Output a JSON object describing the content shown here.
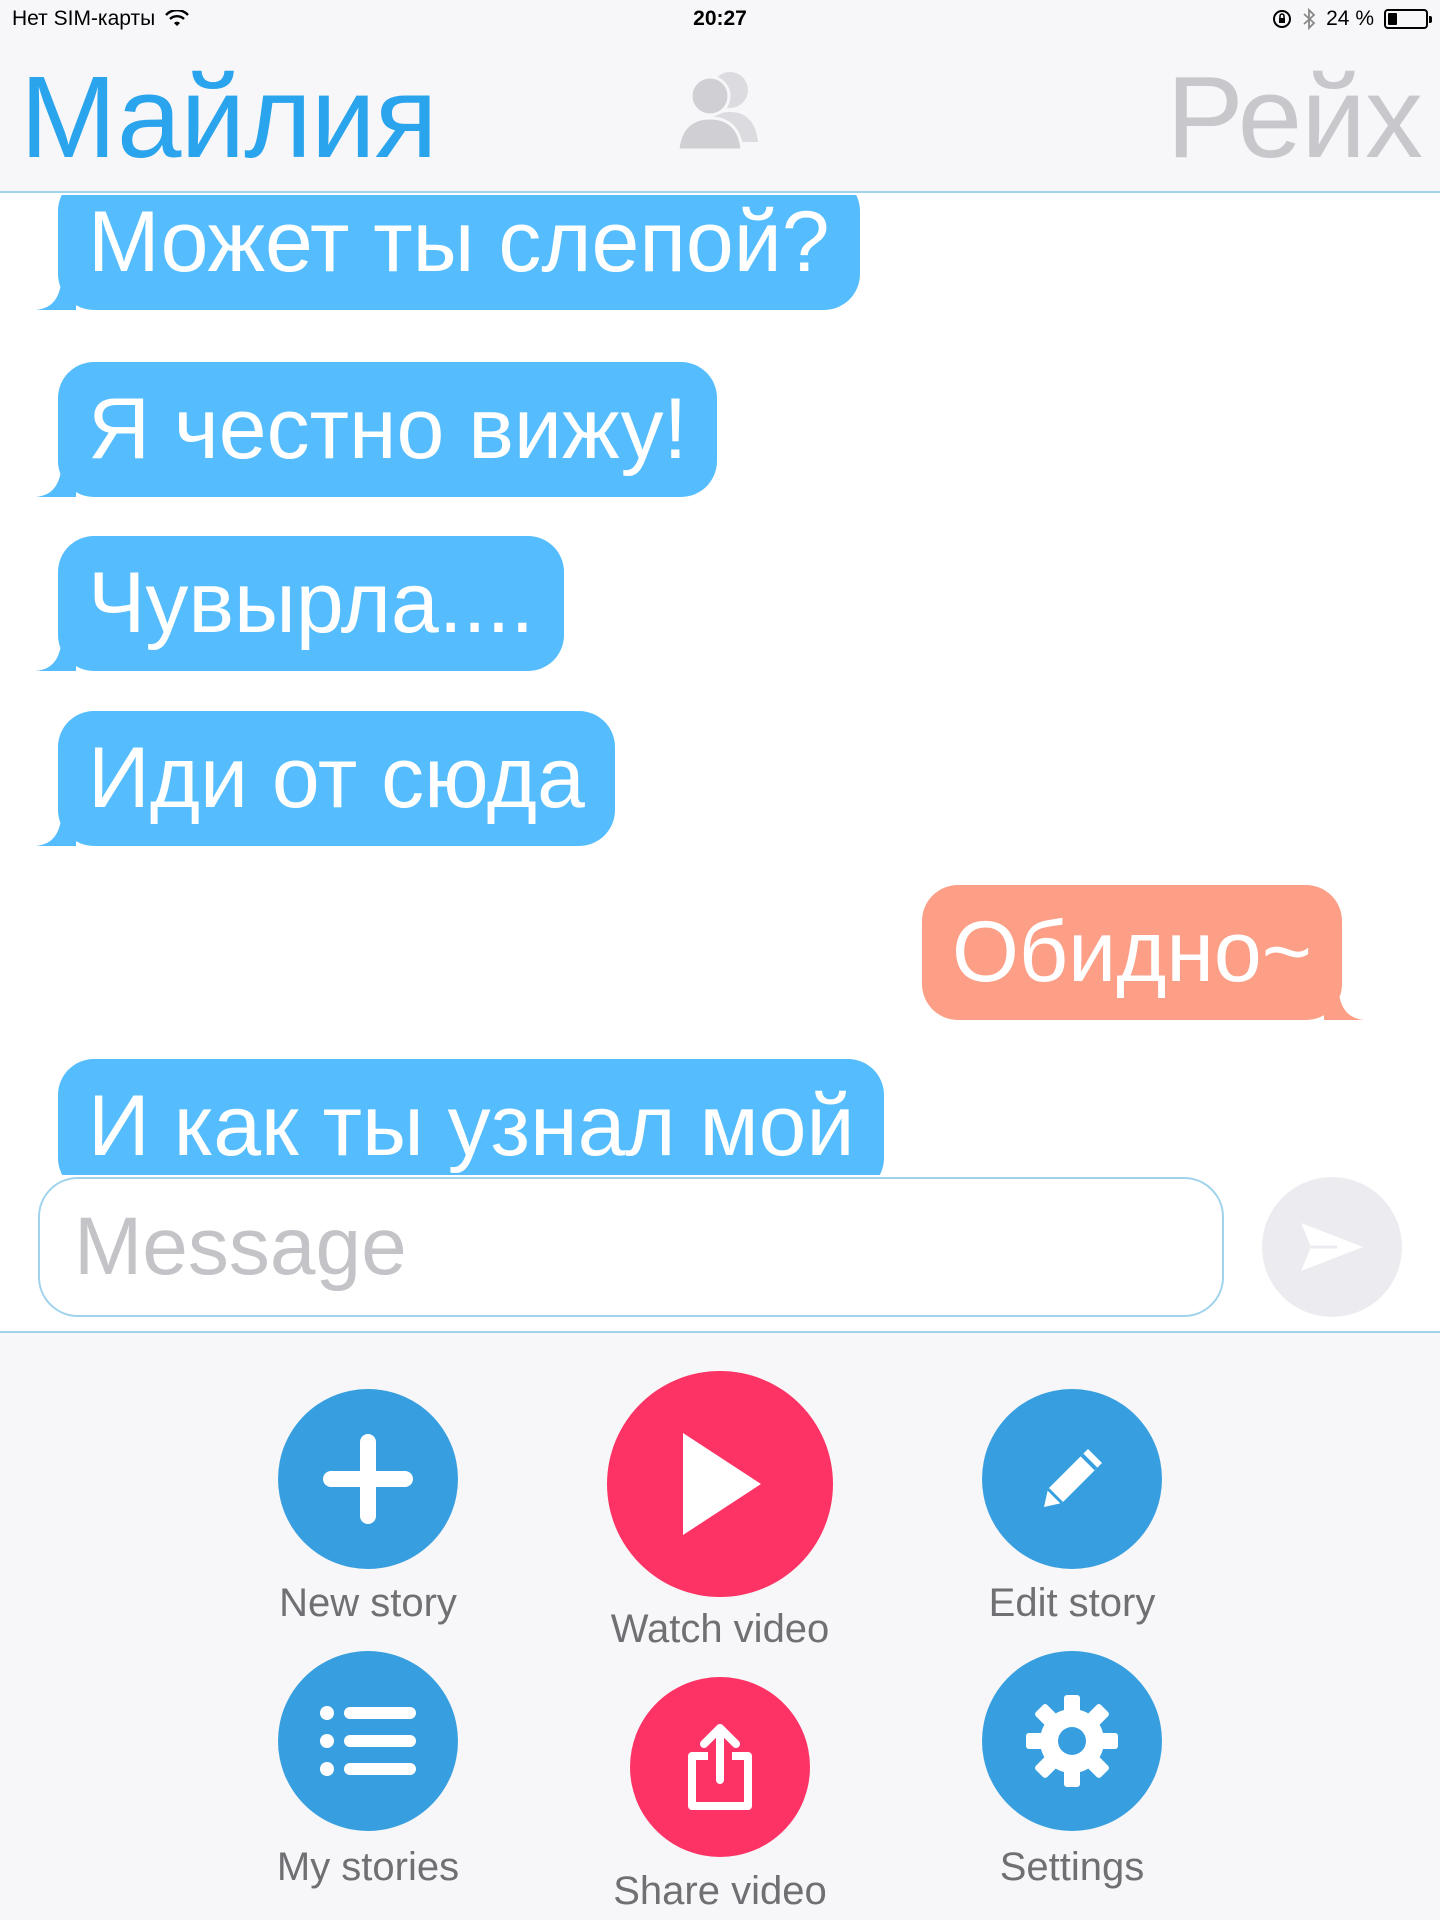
{
  "status_bar": {
    "carrier": "Нет SIM-карты",
    "time": "20:27",
    "battery_text": "24 %",
    "battery_level": 0.24
  },
  "header": {
    "left_name": "Майлия",
    "right_name": "Рейх",
    "left_color": "#2aa4ec",
    "right_color": "#c8c8cc"
  },
  "messages": [
    {
      "side": "left",
      "text": "Может ты слепой?"
    },
    {
      "side": "left",
      "text": "Я честно вижу!"
    },
    {
      "side": "left",
      "text": "Чувырла...."
    },
    {
      "side": "left",
      "text": "Иди от сюда"
    },
    {
      "side": "right",
      "text": "Обидно~"
    },
    {
      "side": "left",
      "text": "И как ты узнал мой"
    }
  ],
  "composer": {
    "value": "",
    "placeholder": "Message"
  },
  "actions": {
    "new_story": "New story",
    "watch_video": "Watch video",
    "edit_story": "Edit story",
    "my_stories": "My stories",
    "share_video": "Share video",
    "settings": "Settings"
  },
  "colors": {
    "incoming_bubble": "#55bdfd",
    "outgoing_bubble": "#fc9f86",
    "action_blue": "#379fdf",
    "action_pink": "#fd3366",
    "divider": "#9fd3ec"
  }
}
